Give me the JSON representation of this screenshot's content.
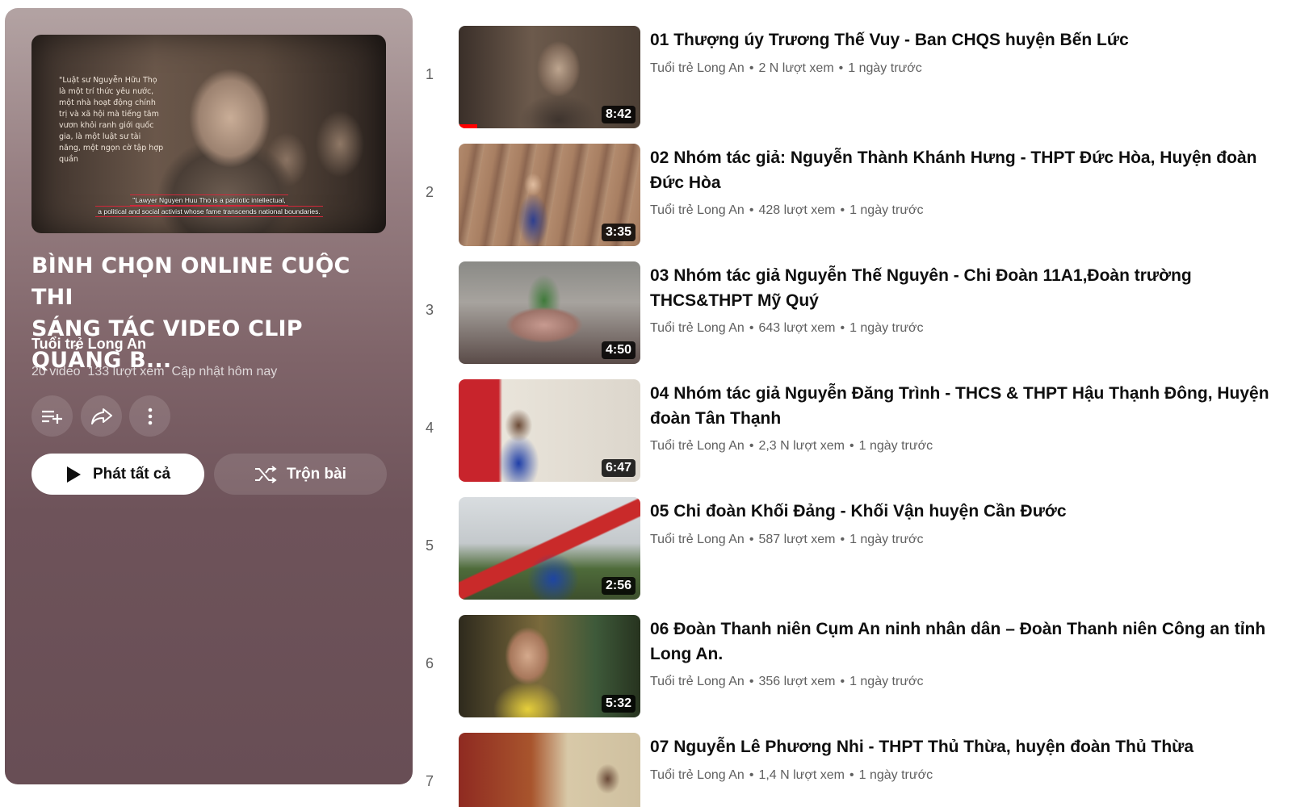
{
  "playlist": {
    "hero_quote": "\"Luật sư Nguyễn Hữu Thọ là một trí thức yêu nước, một nhà hoạt động chính trị và xã hội mà tiếng tăm vươn khỏi ranh giới quốc gia, là một luật sư tài năng, một ngọn cờ tập hợp quần",
    "hero_caption_line1": "\"Lawyer Nguyen Huu Tho is a patriotic intellectual,",
    "hero_caption_line2": "a political and social activist whose fame transcends national boundaries.",
    "title": "BÌNH CHỌN ONLINE CUỘC THI\nSÁNG TÁC VIDEO CLIP QUẢNG B...",
    "channel": "Tuổi trẻ Long An",
    "video_count": "20 video",
    "views": "133 lượt xem",
    "updated": "Cập nhật hôm nay",
    "play_all_label": "Phát tất cả",
    "shuffle_label": "Trộn bài",
    "icons": {
      "save": "add-to-queue-icon",
      "share": "share-icon",
      "more": "more-vert-icon",
      "play": "play-icon",
      "shuffle": "shuffle-icon"
    }
  },
  "videos": [
    {
      "index": "1",
      "title": "01 Thượng úy Trương Thế Vuy - Ban CHQS huyện Bến Lức",
      "channel": "Tuổi trẻ Long An",
      "views": "2 N lượt xem",
      "age": "1 ngày trước",
      "duration": "8:42",
      "watched_fraction": 0.1
    },
    {
      "index": "2",
      "title": "02 Nhóm tác giả: Nguyễn Thành Khánh Hưng - THPT Đức Hòa, Huyện đoàn Đức Hòa",
      "channel": "Tuổi trẻ Long An",
      "views": "428 lượt xem",
      "age": "1 ngày trước",
      "duration": "3:35"
    },
    {
      "index": "3",
      "title": "03 Nhóm tác giả Nguyễn Thế Nguyên - Chi Đoàn 11A1,Đoàn trường THCS&THPT Mỹ Quý",
      "channel": "Tuổi trẻ Long An",
      "views": "643 lượt xem",
      "age": "1 ngày trước",
      "duration": "4:50"
    },
    {
      "index": "4",
      "title": "04 Nhóm tác giả Nguyễn Đăng Trình - THCS & THPT Hậu Thạnh Đông, Huyện đoàn Tân Thạnh",
      "channel": "Tuổi trẻ Long An",
      "views": "2,3 N lượt xem",
      "age": "1 ngày trước",
      "duration": "6:47"
    },
    {
      "index": "5",
      "title": "05 Chi đoàn Khối Đảng - Khối Vận huyện Cần Đước",
      "channel": "Tuổi trẻ Long An",
      "views": "587 lượt xem",
      "age": "1 ngày trước",
      "duration": "2:56"
    },
    {
      "index": "6",
      "title": "06 Đoàn Thanh niên Cụm An ninh nhân dân – Đoàn Thanh niên Công an tỉnh Long An.",
      "channel": "Tuổi trẻ Long An",
      "views": "356 lượt xem",
      "age": "1 ngày trước",
      "duration": "5:32"
    },
    {
      "index": "7",
      "title": "07 Nguyễn Lê Phương Nhi - THPT Thủ Thừa, huyện đoàn Thủ Thừa",
      "channel": "Tuổi trẻ Long An",
      "views": "1,4 N lượt xem",
      "age": "1 ngày trước",
      "duration": ""
    }
  ],
  "separator": "•"
}
